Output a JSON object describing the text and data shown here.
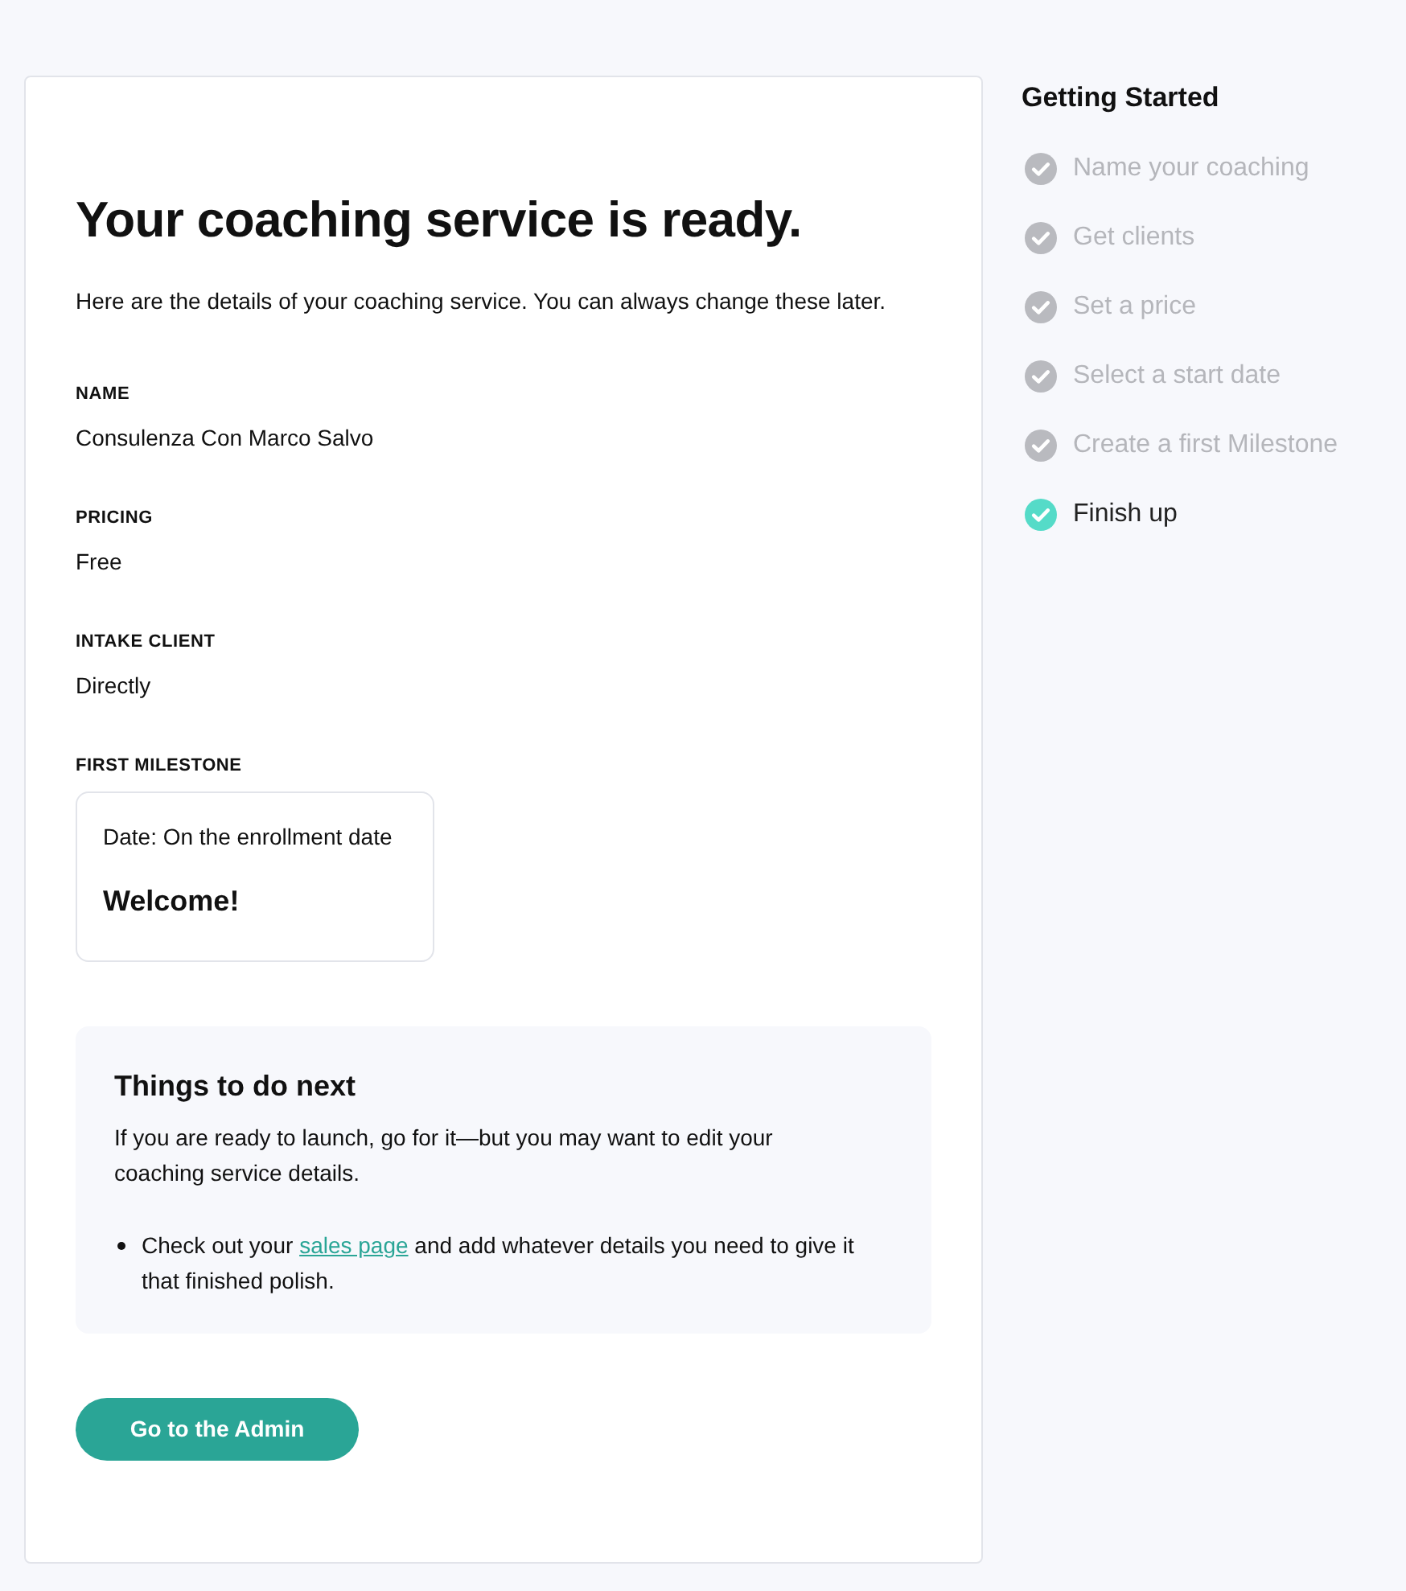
{
  "main": {
    "title": "Your coaching service is ready.",
    "intro": "Here are the details of your coaching service. You can always change these later.",
    "details": [
      {
        "label": "NAME",
        "value": "Consulenza Con Marco Salvo"
      },
      {
        "label": "PRICING",
        "value": "Free"
      },
      {
        "label": "INTAKE CLIENT",
        "value": "Directly"
      }
    ],
    "milestone": {
      "label": "FIRST MILESTONE",
      "date": "Date: On the enrollment date",
      "title": "Welcome!"
    },
    "next_steps": {
      "title": "Things to do next",
      "text": "If you are ready to launch, go for it—but you may want to edit your coaching service details.",
      "items": [
        {
          "before": "Check out your",
          "link": "sales page",
          "after": "and add whatever details you need to give it that finished polish."
        }
      ]
    },
    "button": "Go to the Admin"
  },
  "sidebar": {
    "title": "Getting Started",
    "steps": [
      {
        "label": "Name your coaching",
        "current": false
      },
      {
        "label": "Get clients",
        "current": false
      },
      {
        "label": "Set a price",
        "current": false
      },
      {
        "label": "Select a start date",
        "current": false
      },
      {
        "label": "Create a first Milestone",
        "current": false
      },
      {
        "label": "Finish up",
        "current": true
      }
    ]
  }
}
